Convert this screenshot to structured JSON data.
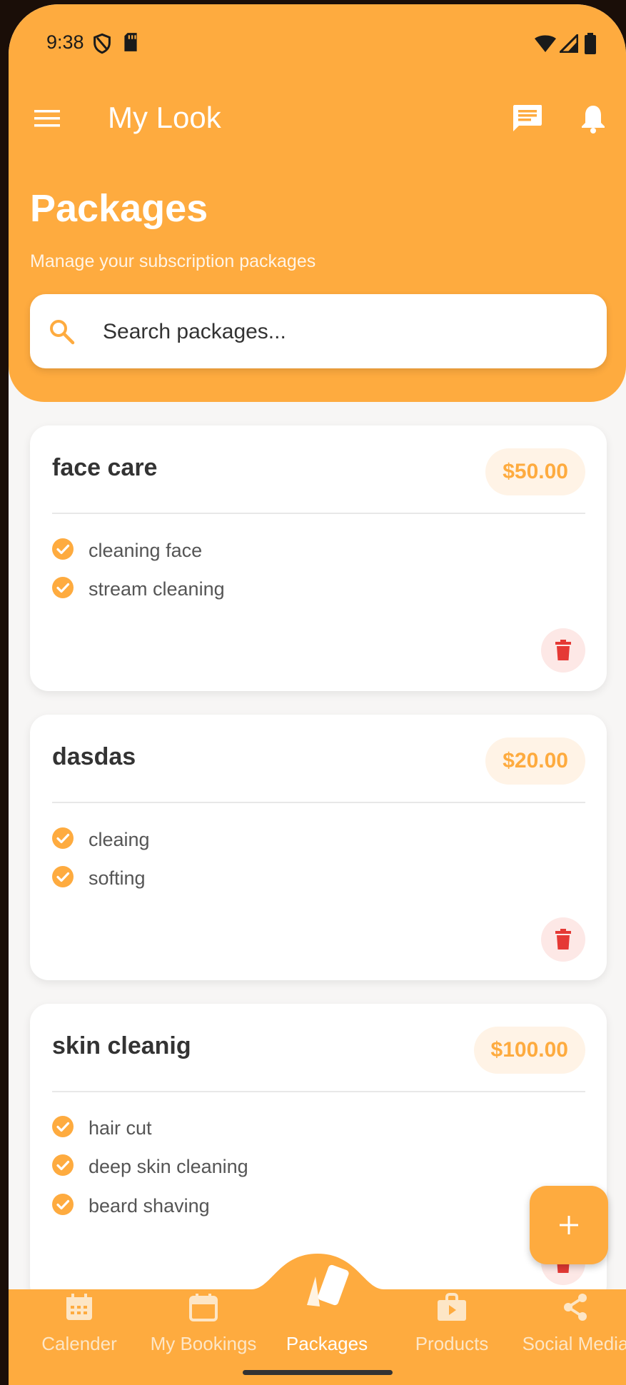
{
  "status_bar": {
    "time": "9:38"
  },
  "app_bar": {
    "title": "My Look"
  },
  "page": {
    "title": "Packages",
    "subtitle": "Manage your subscription packages"
  },
  "search": {
    "placeholder": "Search packages..."
  },
  "packages": [
    {
      "name": "face care",
      "price": "$50.00",
      "features": [
        "cleaning face",
        "stream cleaning"
      ]
    },
    {
      "name": "dasdas",
      "price": "$20.00",
      "features": [
        "cleaing",
        "softing"
      ]
    },
    {
      "name": "skin cleanig",
      "price": "$100.00",
      "features": [
        "hair cut",
        "deep skin cleaning",
        "beard shaving"
      ]
    }
  ],
  "bottom_nav": {
    "items": [
      {
        "label": "Calender",
        "icon": "calendar-grid-icon"
      },
      {
        "label": "My Bookings",
        "icon": "calendar-icon"
      },
      {
        "label": "Packages",
        "icon": "packages-icon",
        "active": true
      },
      {
        "label": "Products",
        "icon": "shopping-bag-icon"
      },
      {
        "label": "Social Media",
        "icon": "share-icon"
      }
    ]
  },
  "colors": {
    "primary": "#FEAB3F",
    "background": "#F7F6F5",
    "card": "#FFFFFF",
    "price_badge_bg": "#FFF3E6",
    "delete": "#E53935",
    "delete_bg": "#FDE8E6",
    "text_dark": "#333333",
    "text_muted": "#555555"
  }
}
